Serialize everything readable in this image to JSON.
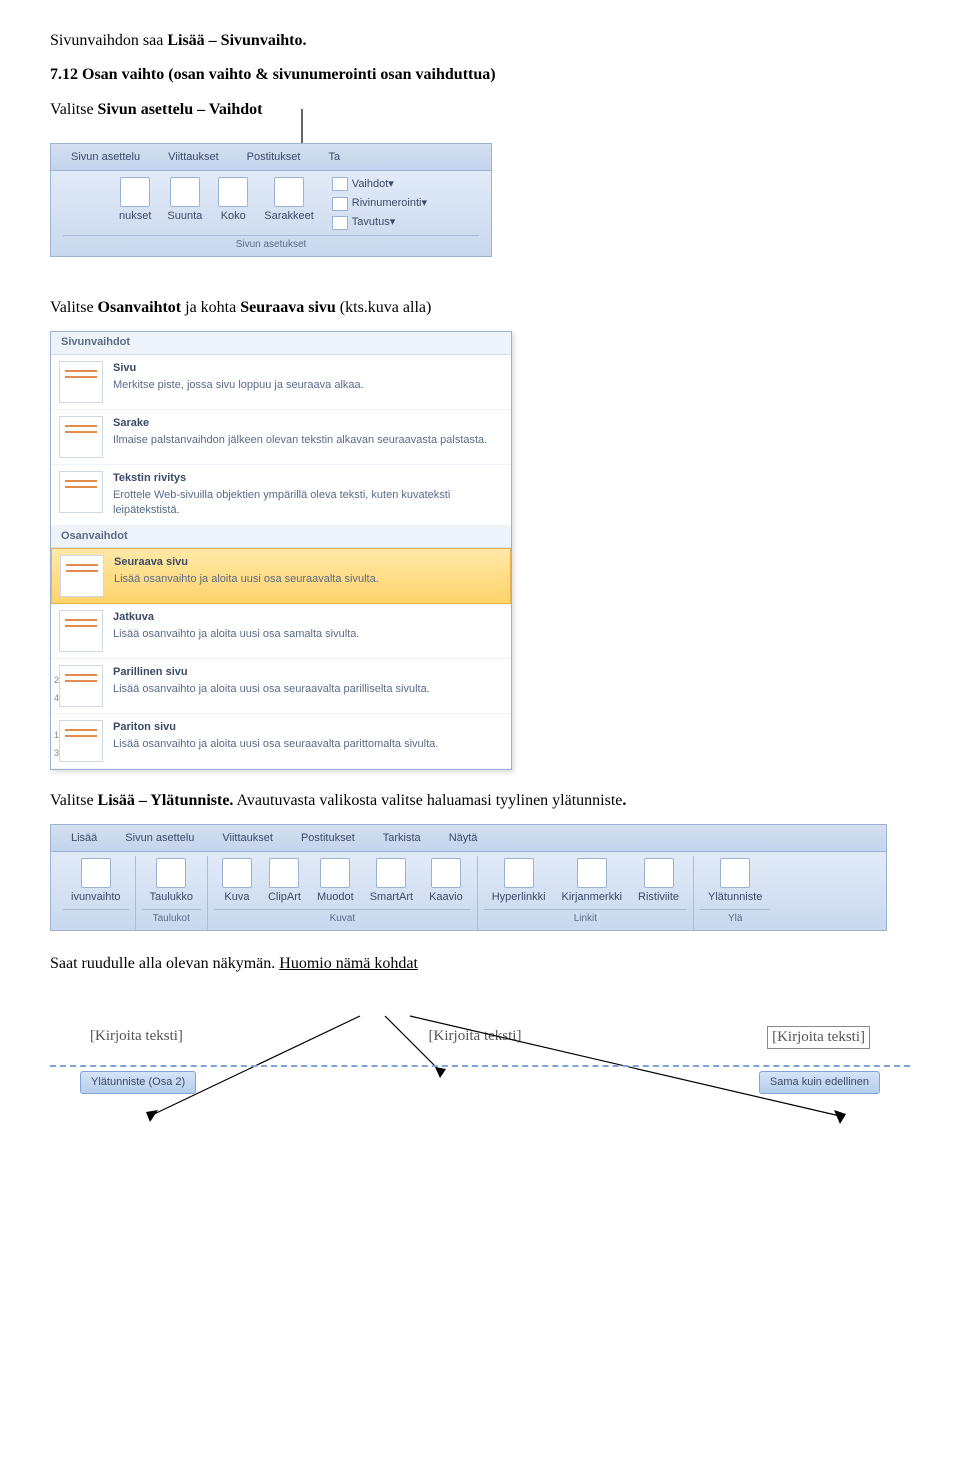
{
  "intro1_a": "Sivunvaihdon saa ",
  "intro1_b": "Lisää – Sivunvaihto.",
  "heading": "7.12 Osan vaihto (osan vaihto & sivunumerointi osan vaihduttua)",
  "intro2_a": "Valitse ",
  "intro2_b": "Sivun asettelu – Vaihdot",
  "ribbon1": {
    "tabs": [
      "Sivun asettelu",
      "Viittaukset",
      "Postitukset",
      "Ta"
    ],
    "buttons": [
      "nukset",
      "Suunta",
      "Koko",
      "Sarakkeet"
    ],
    "side": [
      "Vaihdot",
      "Rivinumerointi",
      "Tavutus"
    ],
    "group": "Sivun asetukset"
  },
  "para2_a": "Valitse ",
  "para2_b": "Osanvaihtot",
  "para2_c": " ja kohta ",
  "para2_d": "Seuraava sivu",
  "para2_e": " (kts.kuva alla)",
  "dropdown": {
    "header1": "Sivunvaihdot",
    "items1": [
      {
        "t": "Sivu",
        "d": "Merkitse piste, jossa sivu loppuu ja seuraava alkaa."
      },
      {
        "t": "Sarake",
        "d": "Ilmaise palstanvaihdon jälkeen olevan tekstin alkavan seuraavasta palstasta."
      },
      {
        "t": "Tekstin rivitys",
        "d": "Erottele Web-sivuilla objektien ympärillä oleva teksti, kuten kuvateksti leipätekstistä."
      }
    ],
    "header2": "Osanvaihdot",
    "items2": [
      {
        "t": "Seuraava sivu",
        "d": "Lisää osanvaihto ja aloita uusi osa seuraavalta sivulta.",
        "hl": true
      },
      {
        "t": "Jatkuva",
        "d": "Lisää osanvaihto ja aloita uusi osa samalta sivulta."
      },
      {
        "t": "Parillinen sivu",
        "d": "Lisää osanvaihto ja aloita uusi osa seuraavalta parilliselta sivulta.",
        "n": [
          "2",
          "4"
        ]
      },
      {
        "t": "Pariton sivu",
        "d": "Lisää osanvaihto ja aloita uusi osa seuraavalta parittomalta sivulta.",
        "n": [
          "1",
          "3"
        ]
      }
    ]
  },
  "para3_a": "Valitse ",
  "para3_b": "Lisää – Ylätunniste.",
  "para3_c": " Avautuvasta valikosta valitse haluamasi tyylinen ylätunniste",
  "para3_d": ".",
  "ribbon2": {
    "tabs": [
      "Lisää",
      "Sivun asettelu",
      "Viittaukset",
      "Postitukset",
      "Tarkista",
      "Näytä"
    ],
    "groups": [
      {
        "btns": [
          "ivunvaihto"
        ],
        "label": ""
      },
      {
        "btns": [
          "Taulukko"
        ],
        "label": "Taulukot"
      },
      {
        "btns": [
          "Kuva",
          "ClipArt",
          "Muodot",
          "SmartArt",
          "Kaavio"
        ],
        "label": "Kuvat"
      },
      {
        "btns": [
          "Hyperlinkki",
          "Kirjanmerkki",
          "Ristiviite"
        ],
        "label": "Linkit"
      },
      {
        "btns": [
          "Ylätunniste"
        ],
        "label": "Ylä"
      }
    ]
  },
  "para4_a": "Saat ruudulle alla olevan näkymän. ",
  "para4_b": "Huomio nämä kohdat",
  "headerrow": {
    "left": "[Kirjoita teksti]",
    "center": "[Kirjoita teksti]",
    "right": "[Kirjoita teksti]"
  },
  "footer_left": "Ylätunniste (Osa 2)",
  "footer_right": "Sama kuin edellinen"
}
